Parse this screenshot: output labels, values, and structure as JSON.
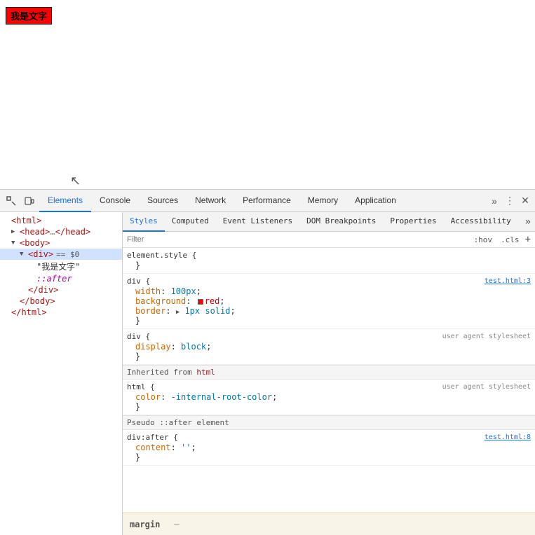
{
  "page": {
    "red_box_text": "我是文字"
  },
  "devtools": {
    "tabs": [
      {
        "label": "Elements",
        "active": true
      },
      {
        "label": "Console"
      },
      {
        "label": "Sources"
      },
      {
        "label": "Network"
      },
      {
        "label": "Performance"
      },
      {
        "label": "Memory"
      },
      {
        "label": "Application"
      }
    ],
    "secondary_tabs": [
      {
        "label": "Styles",
        "active": true
      },
      {
        "label": "Computed"
      },
      {
        "label": "Event Listeners"
      },
      {
        "label": "DOM Breakpoints"
      },
      {
        "label": "Properties"
      },
      {
        "label": "Accessibility"
      }
    ],
    "filter_placeholder": "Filter",
    "hov_btn": ":hov",
    "cls_btn": ".cls",
    "plus_btn": "+",
    "elements_tree": [
      {
        "indent": 0,
        "arrow": "",
        "html": "<html>",
        "type": "tag"
      },
      {
        "indent": 1,
        "arrow": "▶",
        "html": "<head>…</head>",
        "type": "tag"
      },
      {
        "indent": 1,
        "arrow": "▼",
        "html": "<body>",
        "type": "tag"
      },
      {
        "indent": 2,
        "arrow": "▼",
        "html": "<div> == $0",
        "type": "tag",
        "selected": true
      },
      {
        "indent": 3,
        "arrow": "",
        "html": "\"我是文字\"",
        "type": "string"
      },
      {
        "indent": 3,
        "arrow": "",
        "html": "::after",
        "type": "pseudo"
      },
      {
        "indent": 2,
        "arrow": "",
        "html": "</div>",
        "type": "close"
      },
      {
        "indent": 1,
        "arrow": "",
        "html": "</body>",
        "type": "close"
      },
      {
        "indent": 0,
        "arrow": "",
        "html": "</html>",
        "type": "close"
      }
    ],
    "styles": {
      "element_style": {
        "selector": "element.style {",
        "close": "}",
        "properties": []
      },
      "div_block": {
        "selector": "div {",
        "source": "test.html:3",
        "close": "}",
        "properties": [
          {
            "name": "width",
            "value": "100px",
            "colon": ": ",
            "semi": ";"
          },
          {
            "name": "background",
            "has_swatch": true,
            "swatch_color": "red",
            "value": "red",
            "colon": ": ",
            "semi": ";"
          },
          {
            "name": "border",
            "has_expand": true,
            "value": " 1px solid",
            "colon": ": ",
            "semi": ";"
          }
        ]
      },
      "div_ua_block": {
        "selector": "div {",
        "source": "user agent stylesheet",
        "close": "}",
        "properties": [
          {
            "name": "display",
            "value": "block",
            "colon": ": ",
            "semi": ";"
          }
        ]
      },
      "inherited_from": "html",
      "html_ua_block": {
        "selector": "html {",
        "source": "user agent stylesheet",
        "close": "}",
        "properties": [
          {
            "name": "color",
            "value": "-internal-root-color",
            "colon": ": ",
            "semi": ";"
          }
        ]
      },
      "pseudo_label": "Pseudo ::after element",
      "div_after_block": {
        "selector": "div:after {",
        "source": "test.html:8",
        "close": "}",
        "properties": [
          {
            "name": "content",
            "value": "''",
            "colon": ": ",
            "semi": ";"
          }
        ]
      }
    },
    "box_model": {
      "label": "margin",
      "dash": "–"
    }
  }
}
